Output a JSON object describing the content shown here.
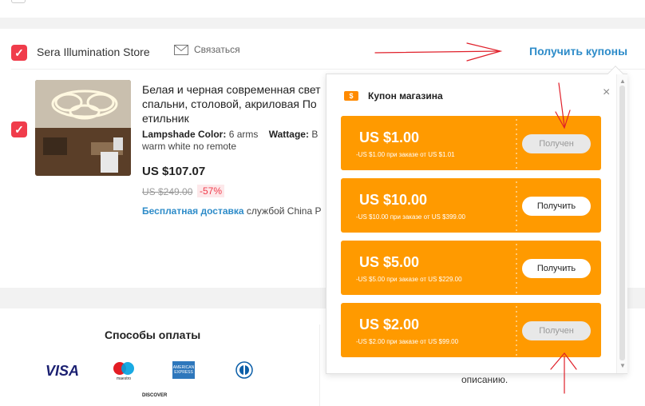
{
  "store": {
    "name": "Sera Illumination Store",
    "contact_label": "Связаться",
    "get_coupons_label": "Получить купоны"
  },
  "product": {
    "title_line1": "Белая и черная современная свет",
    "title_line2": "спальни, столовой, акриловая По",
    "title_line3": "етильник",
    "attr_lampshade_key": "Lampshade Color:",
    "attr_lampshade_val": "6 arms",
    "attr_wattage_key": "Wattage:",
    "attr_wattage_val": "B",
    "attr_line2": "warm white no remote",
    "price": "US $107.07",
    "old_price": "US $249.00",
    "discount": "-57%",
    "shipping_free": "Бесплатная доставка",
    "shipping_rest": "службой China P"
  },
  "payment": {
    "title": "Способы оплаты",
    "visa": "VISA",
    "amex": "AMERICAN EXPRESS",
    "discover": "DISCOVER",
    "mc_caption": "maestro",
    "desc": "описанию."
  },
  "popup": {
    "title": "Купон магазина",
    "close": "×",
    "coupons": [
      {
        "amount": "US $1.00",
        "condition": "-US $1.00 при заказе от US $1.01",
        "button": "Получен",
        "state": "received"
      },
      {
        "amount": "US $10.00",
        "condition": "-US $10.00 при заказе от US $399.00",
        "button": "Получить",
        "state": "active"
      },
      {
        "amount": "US $5.00",
        "condition": "-US $5.00 при заказе от US $229.00",
        "button": "Получить",
        "state": "active"
      },
      {
        "amount": "US $2.00",
        "condition": "-US $2.00 при заказе от US $99.00",
        "button": "Получен",
        "state": "received"
      }
    ]
  },
  "colors": {
    "accent_red": "#f03c4b",
    "coupon_orange": "#ff9a00",
    "link_blue": "#2e8cc9",
    "annotation_red": "#e0202a"
  },
  "icons": {
    "check": "✓",
    "coupon": "$",
    "scroll_up": "▲",
    "scroll_down": "▼"
  }
}
